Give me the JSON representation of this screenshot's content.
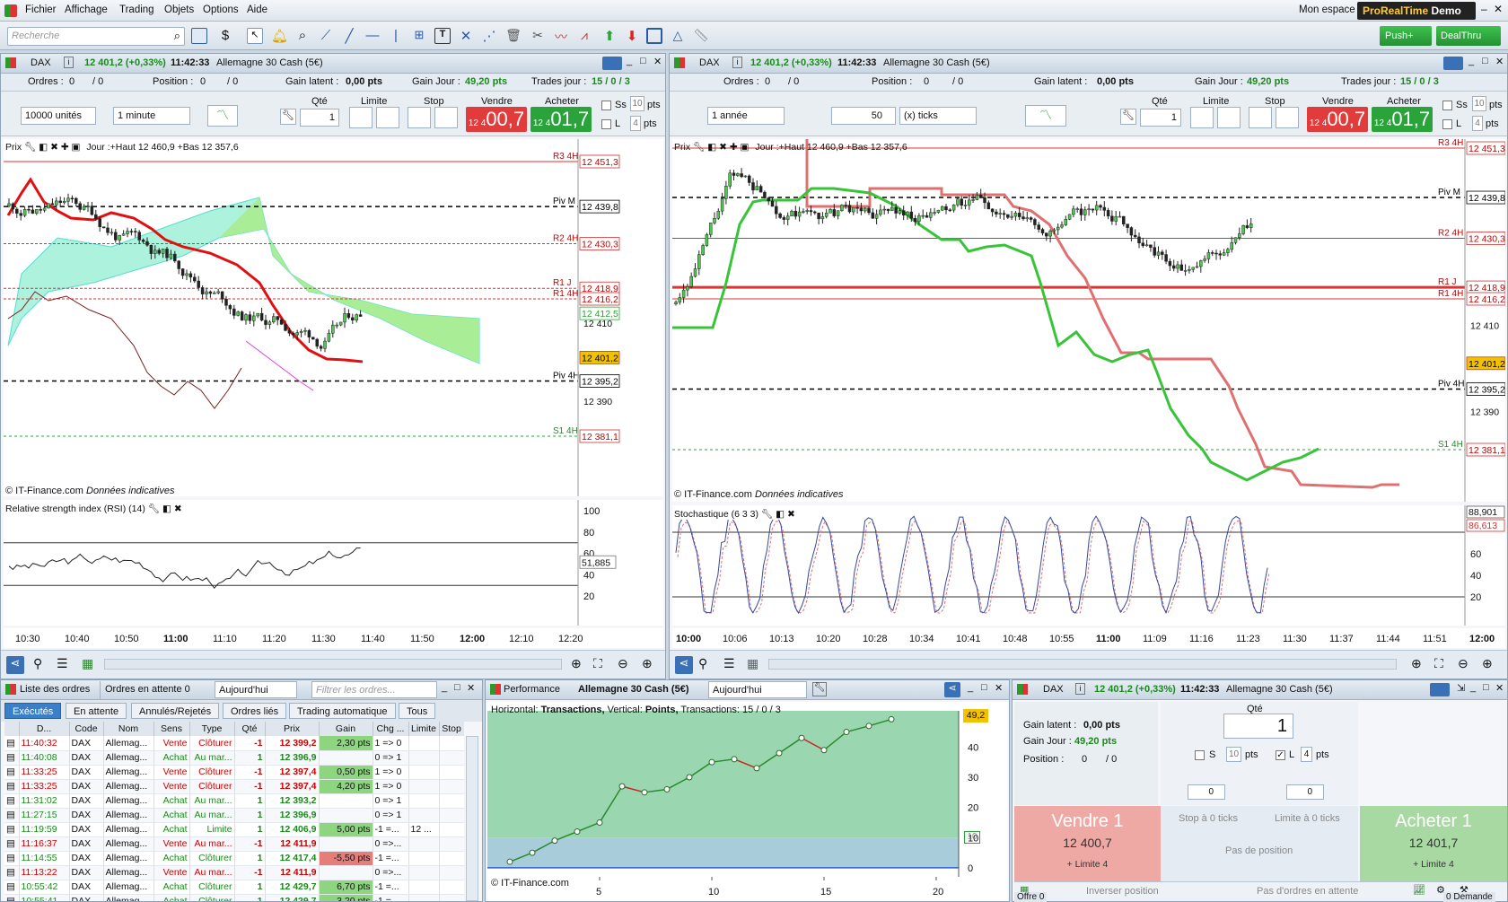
{
  "menu": {
    "items": [
      "Fichier",
      "Affichage",
      "Trading",
      "Objets",
      "Options",
      "Aide"
    ],
    "mon_espace": "Mon espace",
    "brand": "ProRealTime",
    "brand_demo": "Demo"
  },
  "toolbar": {
    "search_placeholder": "Recherche",
    "push": "Push+",
    "dealthru": "DealThru"
  },
  "left_chart": {
    "instrument": "DAX",
    "quote": "12 401,2 (+0,33%)",
    "time": "11:42:33",
    "name": "Allemagne 30 Cash (5€)",
    "ordres_label": "Ordres :",
    "ordres_val": "0",
    "ordres_val2": "/ 0",
    "position_label": "Position :",
    "position_val": "0",
    "position_val2": "/ 0",
    "gain_latent_label": "Gain latent :",
    "gain_latent": "0,00 pts",
    "gain_jour_label": "Gain Jour :",
    "gain_jour": "49,20 pts",
    "trades_label": "Trades jour :",
    "trades": "15 / 0 / 3",
    "units": "10000 unités",
    "interval": "1 minute",
    "qte_label": "Qté",
    "qte": "1",
    "limite": "Limite",
    "stop": "Stop",
    "vendre": "Vendre",
    "acheter": "Acheter",
    "sell_small": "12 4",
    "sell_big": "00,7",
    "buy_small": "12 4",
    "buy_big": "01,7",
    "ss": "Ss",
    "ss_val": "10",
    "l": "L",
    "l_val": "4",
    "pts": "pts",
    "prix": "Prix",
    "jour": "Jour :+Haut 12 460,9 +Bas 12 357,6",
    "copyright": "© IT-Finance.com",
    "indicatives": "Données indicatives",
    "rsi_title": "Relative strength index (RSI) (14)",
    "rsi_val": "51,885",
    "levels": [
      {
        "label": "R3 4H",
        "value": "12 451,3"
      },
      {
        "label": "Piv M",
        "value": "12 439,8"
      },
      {
        "label": "R2 4H",
        "value": "12 430,3"
      },
      {
        "label": "R1 J",
        "value": "12 418,9"
      },
      {
        "label": "R1 4H",
        "value": "12 416,2"
      },
      {
        "label": "",
        "value": "12 412,5"
      },
      {
        "label": "",
        "value": "12 401,2"
      },
      {
        "label": "Piv 4H",
        "value": "12 395,2"
      },
      {
        "label": "S1 4H",
        "value": "12 381,1"
      }
    ],
    "axis_prices": [
      "12 410",
      "12 390"
    ],
    "rsi_axis": [
      "100",
      "80",
      "60",
      "40",
      "20"
    ],
    "time_axis": [
      "10:30",
      "10:40",
      "10:50",
      "11:00",
      "11:10",
      "11:20",
      "11:30",
      "11:40",
      "11:50",
      "12:00",
      "12:10",
      "12:20"
    ]
  },
  "right_chart": {
    "instrument": "DAX",
    "quote": "12 401,2 (+0,33%)",
    "time": "11:42:33",
    "name": "Allemagne 30 Cash (5€)",
    "ordres_label": "Ordres :",
    "ordres_val": "0",
    "ordres_val2": "/ 0",
    "position_label": "Position :",
    "position_val": "0",
    "position_val2": "/ 0",
    "gain_latent_label": "Gain latent :",
    "gain_latent": "0,00 pts",
    "gain_jour_label": "Gain Jour :",
    "gain_jour": "49,20 pts",
    "trades_label": "Trades jour :",
    "trades": "15 / 0 / 3",
    "period": "1 année",
    "ticks_val": "50",
    "ticks": "(x) ticks",
    "qte_label": "Qté",
    "qte": "1",
    "limite": "Limite",
    "stop": "Stop",
    "vendre": "Vendre",
    "acheter": "Acheter",
    "sell_small": "12 4",
    "sell_big": "00,7",
    "buy_small": "12 4",
    "buy_big": "01,7",
    "ss": "Ss",
    "ss_val": "10",
    "l": "L",
    "l_val": "4",
    "pts": "pts",
    "prix": "Prix",
    "jour": "Jour :+Haut 12 460,9 +Bas 12 357,6",
    "copyright": "© IT-Finance.com",
    "indicatives": "Données indicatives",
    "stoch_title": "Stochastique (6 3 3)",
    "stoch_val1": "88,901",
    "stoch_val2": "86,613",
    "levels": [
      {
        "label": "R3 4H",
        "value": "12 451,3"
      },
      {
        "label": "Piv M",
        "value": "12 439,8"
      },
      {
        "label": "R2 4H",
        "value": "12 430,3"
      },
      {
        "label": "R1 J",
        "value": "12 418,9"
      },
      {
        "label": "R1 4H",
        "value": "12 416,2"
      },
      {
        "label": "",
        "value": "12 401,2"
      },
      {
        "label": "Piv 4H",
        "value": "12 395,2"
      },
      {
        "label": "S1 4H",
        "value": "12 381,1"
      }
    ],
    "axis_prices": [
      "12 410",
      "12 390"
    ],
    "stoch_axis": [
      "100",
      "60",
      "40",
      "20"
    ],
    "time_axis": [
      "10:00",
      "10:06",
      "10:13",
      "10:20",
      "10:28",
      "10:34",
      "10:41",
      "10:48",
      "10:55",
      "11:00",
      "11:09",
      "11:16",
      "11:23",
      "11:30",
      "11:37",
      "11:44",
      "11:51",
      "12:00"
    ]
  },
  "orders": {
    "title": "Liste des ordres",
    "pending": "Ordres en attente",
    "pending_count": "0",
    "date_filter": "Aujourd'hui",
    "filter_placeholder": "Filtrer les ordres...",
    "tabs": [
      "Exécutés",
      "En attente",
      "Annulés/Rejetés",
      "Ordres liés",
      "Trading automatique",
      "Tous"
    ],
    "headers": [
      "D...",
      "Code",
      "Nom",
      "Sens",
      "Type",
      "Qté",
      "Prix",
      "Gain",
      "Chg ...",
      "Limite",
      "Stop"
    ],
    "rows": [
      [
        "11:40:32",
        "DAX",
        "Allemag...",
        "Vente",
        "Clôturer",
        "-1",
        "12 399,2",
        "2,30 pts",
        "1 => 0",
        "",
        ""
      ],
      [
        "11:40:08",
        "DAX",
        "Allemag...",
        "Achat",
        "Au mar...",
        "1",
        "12 396,9",
        "",
        "0 => 1",
        "",
        ""
      ],
      [
        "11:33:25",
        "DAX",
        "Allemag...",
        "Vente",
        "Clôturer",
        "-1",
        "12 397,4",
        "0,50 pts",
        "1 => 0",
        "",
        ""
      ],
      [
        "11:33:25",
        "DAX",
        "Allemag...",
        "Vente",
        "Clôturer",
        "-1",
        "12 397,4",
        "4,20 pts",
        "1 => 0",
        "",
        ""
      ],
      [
        "11:31:02",
        "DAX",
        "Allemag...",
        "Achat",
        "Au mar...",
        "1",
        "12 393,2",
        "",
        "0 => 1",
        "",
        ""
      ],
      [
        "11:27:15",
        "DAX",
        "Allemag...",
        "Achat",
        "Au mar...",
        "1",
        "12 396,9",
        "",
        "0 => 1",
        "",
        ""
      ],
      [
        "11:19:59",
        "DAX",
        "Allemag...",
        "Achat",
        "Limite",
        "1",
        "12 406,9",
        "5,00 pts",
        "-1 =...",
        "12 ...",
        ""
      ],
      [
        "11:16:37",
        "DAX",
        "Allemag...",
        "Vente",
        "Au mar...",
        "-1",
        "12 411,9",
        "",
        "0 =>...",
        "",
        ""
      ],
      [
        "11:14:55",
        "DAX",
        "Allemag...",
        "Achat",
        "Clôturer",
        "1",
        "12 417,4",
        "-5,50 pts",
        "-1 =...",
        "",
        ""
      ],
      [
        "11:13:22",
        "DAX",
        "Allemag...",
        "Vente",
        "Au mar...",
        "-1",
        "12 411,9",
        "",
        "0 =>...",
        "",
        ""
      ],
      [
        "10:55:42",
        "DAX",
        "Allemag...",
        "Achat",
        "Clôturer",
        "1",
        "12 429,7",
        "6,70 pts",
        "-1 =...",
        "",
        ""
      ],
      [
        "10:55:41",
        "DAX",
        "Allemag...",
        "Achat",
        "Clôturer",
        "1",
        "12 429,7",
        "3,20 pts",
        "-1 =...",
        "",
        ""
      ]
    ]
  },
  "performance": {
    "title": "Performance",
    "instrument": "Allemagne 30 Cash (5€)",
    "date_filter": "Aujourd'hui",
    "desc_h": "Horizontal:",
    "desc_h_val": "Transactions,",
    "desc_v": "Vertical:",
    "desc_v_val": "Points,",
    "desc_t": "Transactions:",
    "desc_t_val": "15 / 0 / 3",
    "current": "49,2",
    "copyright": "© IT-Finance.com",
    "side_marker": "10",
    "y_axis": [
      "40",
      "30",
      "20",
      "10",
      "0"
    ],
    "x_axis": [
      "5",
      "10",
      "15",
      "20"
    ]
  },
  "chart_data": {
    "type": "line",
    "x": [
      1,
      2,
      3,
      4,
      5,
      6,
      7,
      8,
      9,
      10,
      11,
      12,
      13,
      14,
      15,
      16,
      17,
      18
    ],
    "y": [
      2,
      5,
      9,
      12,
      15,
      27,
      25,
      26,
      30,
      35,
      36,
      33,
      38,
      43,
      39,
      45,
      47,
      49.2
    ],
    "xlim": [
      0,
      21
    ],
    "ylim": [
      -3,
      52
    ]
  },
  "ticket": {
    "instrument": "DAX",
    "quote": "12 401,2 (+0,33%)",
    "time": "11:42:33",
    "name": "Allemagne 30 Cash (5€)",
    "gain_latent_label": "Gain latent :",
    "gain_latent": "0,00 pts",
    "gain_jour_label": "Gain Jour :",
    "gain_jour": "49,20 pts",
    "position_label": "Position :",
    "position_val": "0",
    "position_val2": "/ 0",
    "qte_label": "Qté",
    "qte": "1",
    "s": "S",
    "s_val": "10",
    "l": "L",
    "l_val": "4",
    "pts": "pts",
    "stop_val": "0",
    "limit_val": "0",
    "sell_title": "Vendre 1",
    "sell_price": "12 400,7",
    "sell_sub": "+ Limite 4",
    "stop_ticks": "Stop à 0 ticks",
    "limit_ticks": "Limite à 0 ticks",
    "no_position": "Pas de position",
    "buy_title": "Acheter 1",
    "buy_price": "12 401,7",
    "buy_sub": "+ Limite 4",
    "reverse": "Inverser position",
    "no_pending": "Pas d'ordres en attente",
    "offre": "Offre",
    "offre_val": "0",
    "demande": "Demande",
    "demande_val": "0"
  },
  "colors": {
    "accent_red": "#e23b3b",
    "accent_green": "#2aa33a",
    "brand_bg": "#222222",
    "brand_text": "#ffcc33"
  }
}
